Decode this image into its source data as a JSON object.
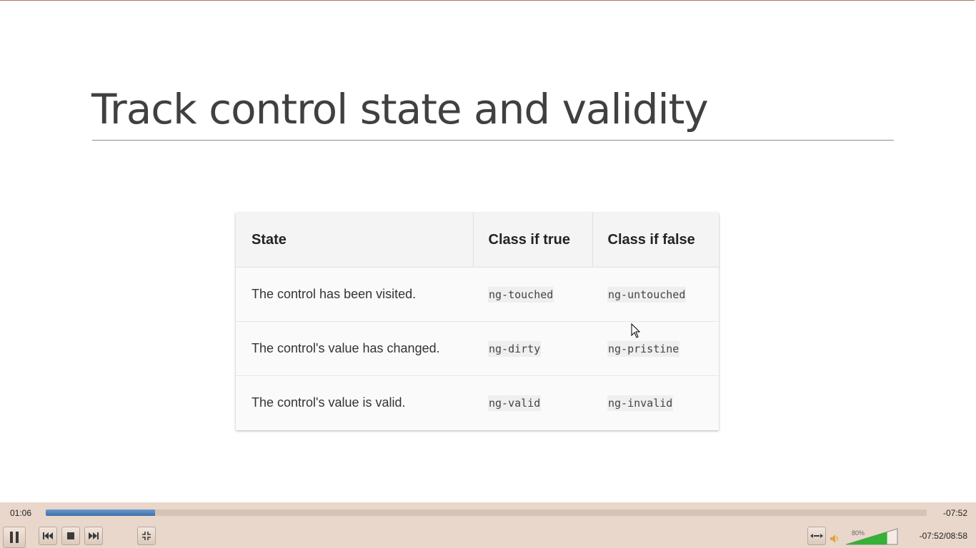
{
  "slide": {
    "title": "Track control state and validity",
    "table": {
      "headers": [
        "State",
        "Class if true",
        "Class if false"
      ],
      "rows": [
        [
          "The control has been visited.",
          "ng-touched",
          "ng-untouched"
        ],
        [
          "The control's value has changed.",
          "ng-dirty",
          "ng-pristine"
        ],
        [
          "The control's value is valid.",
          "ng-valid",
          "ng-invalid"
        ]
      ]
    }
  },
  "player": {
    "elapsed": "01:06",
    "remaining": "-07:52",
    "remaining_total": "-07:52/08:58",
    "progress_fraction": 0.124,
    "volume_label": "80%",
    "volume_fraction": 0.8,
    "colors": {
      "progress": "#4a7fc0",
      "volume": "#36b036",
      "bar_bg": "#e9d7cb"
    },
    "icons": [
      "pause-icon",
      "previous-icon",
      "stop-icon",
      "next-icon",
      "fullscreen-exit-icon",
      "aspect-ratio-icon",
      "speaker-icon"
    ]
  }
}
